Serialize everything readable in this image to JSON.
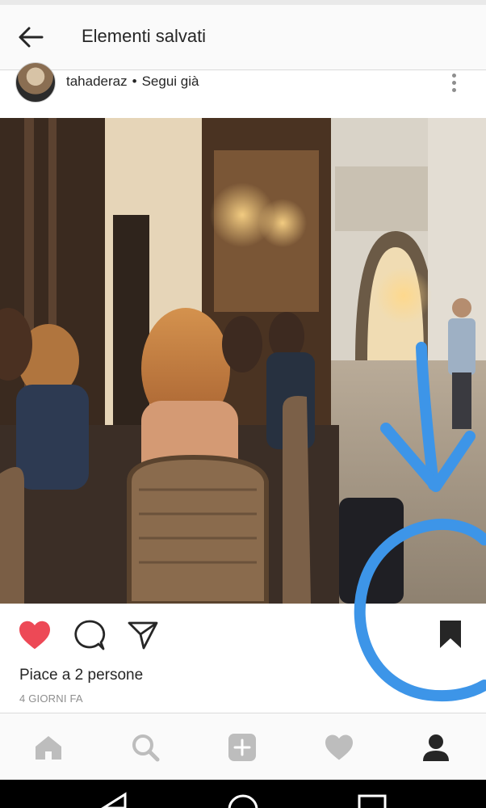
{
  "header": {
    "title": "Elementi salvati"
  },
  "post": {
    "username": "tahaderaz",
    "separator": "•",
    "follow_status": "Segui già",
    "likes_text": "Piace a 2 persone",
    "time_ago": "4 GIORNI FA",
    "liked": true
  },
  "icons": {
    "back": "arrow-left-icon",
    "more": "more-vertical-icon",
    "like": "heart-filled-icon",
    "comment": "comment-icon",
    "share": "send-icon",
    "save": "bookmark-filled-icon"
  },
  "bottom_nav": [
    {
      "name": "home",
      "icon": "home-icon",
      "active": false
    },
    {
      "name": "search",
      "icon": "search-icon",
      "active": false
    },
    {
      "name": "new-post",
      "icon": "plus-square-icon",
      "active": false
    },
    {
      "name": "activity",
      "icon": "heart-icon",
      "active": false
    },
    {
      "name": "profile",
      "icon": "profile-icon",
      "active": true
    }
  ],
  "colors": {
    "like_red": "#ed4956",
    "annotation_blue": "#3d95e8",
    "nav_inactive": "#bdbdbd",
    "nav_active": "#262626"
  }
}
